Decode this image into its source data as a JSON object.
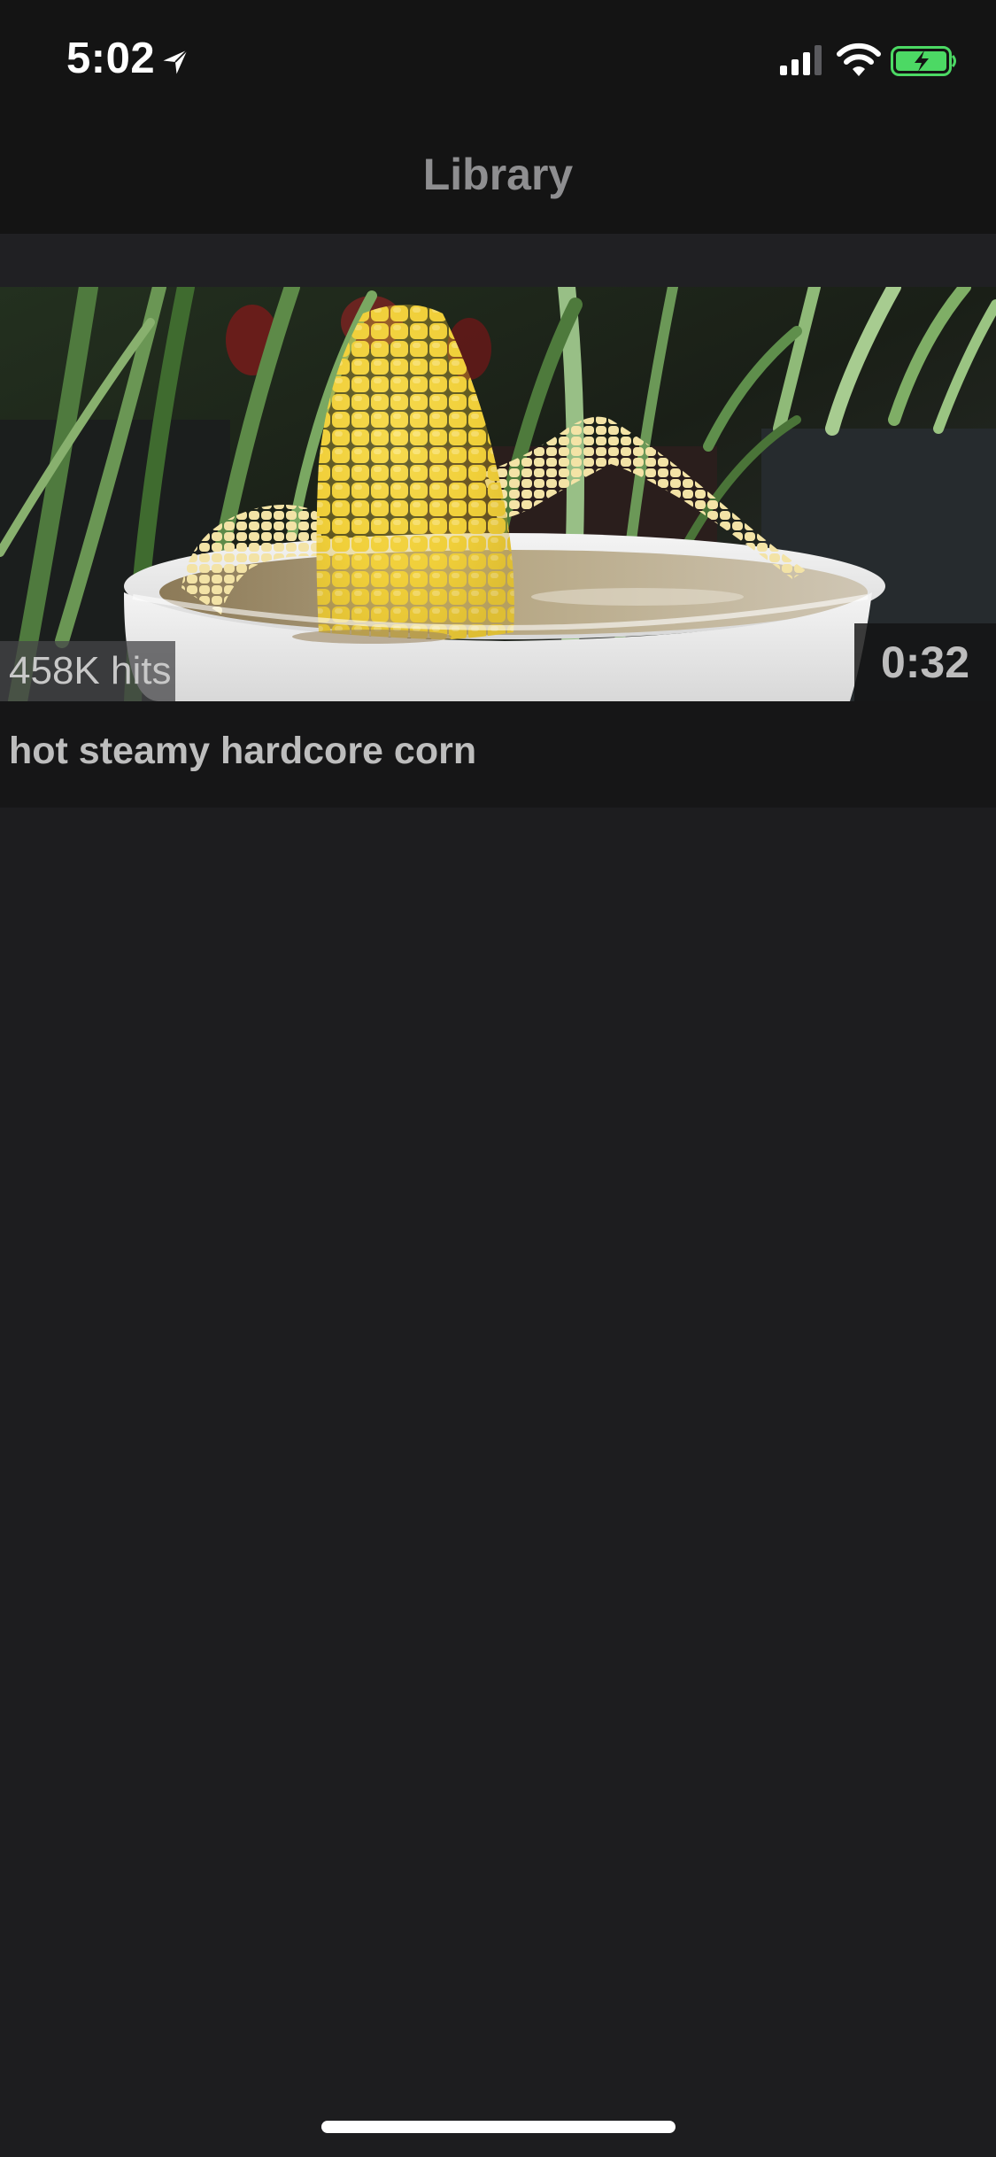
{
  "status_bar": {
    "time": "5:02",
    "icons": [
      "location-arrow-icon",
      "cellular-signal-icon",
      "wifi-icon",
      "battery-charging-icon"
    ],
    "battery_color": "#4cd964"
  },
  "nav": {
    "title": "Library"
  },
  "library": {
    "videos": [
      {
        "title": "hot steamy hardcore corn",
        "hits": "458K hits",
        "duration": "0:32"
      }
    ]
  },
  "colors": {
    "background": "#1d1d1f",
    "nav_background": "#141414",
    "title_text": "#8e8e90"
  }
}
